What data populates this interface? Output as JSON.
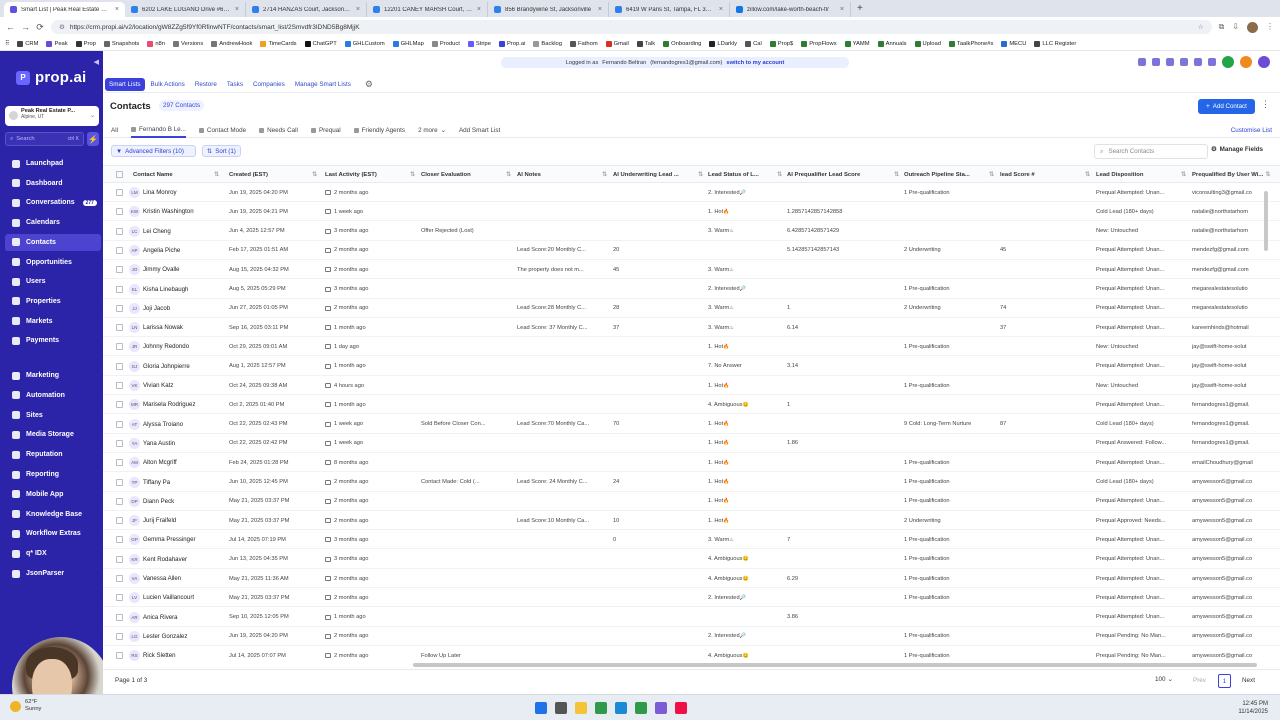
{
  "browser": {
    "tabs": [
      {
        "label": "Smart List | Peak Real Estate Pros",
        "active": true,
        "color": "#5a52e0"
      },
      {
        "label": "6202 LAKE LUGANO Drive #6202",
        "active": false,
        "color": "#2f80ed"
      },
      {
        "label": "2714 HANZAS Court, Jacksonville",
        "active": false,
        "color": "#2f80ed"
      },
      {
        "label": "12201 CANEY MARSH Court, Jack",
        "active": false,
        "color": "#2f80ed"
      },
      {
        "label": "856 Brandywine St, Jacksonville",
        "active": false,
        "color": "#2f80ed"
      },
      {
        "label": "6419 W Paris St, Tampa, FL 3363",
        "active": false,
        "color": "#2f80ed"
      },
      {
        "label": "zillow.com/lake-worth-beach-fl/",
        "active": false,
        "color": "#1277e1"
      }
    ],
    "url": "https://crm.propi.ai/v2/location/gW8ZZg5f9Yf0RfinwNTF/contacts/smart_list/2Smvdfr3IDND5Bg8MjjK",
    "bookmarks": [
      {
        "label": "CRM",
        "color": "#444"
      },
      {
        "label": "Peak",
        "color": "#6b4bd8"
      },
      {
        "label": "Prop",
        "color": "#333"
      },
      {
        "label": "Snapshots",
        "color": "#666"
      },
      {
        "label": "n8n",
        "color": "#ea4b71"
      },
      {
        "label": "Versions",
        "color": "#777"
      },
      {
        "label": "AndrewHook",
        "color": "#777"
      },
      {
        "label": "TimeCards",
        "color": "#f0a020"
      },
      {
        "label": "ChatGPT",
        "color": "#111"
      },
      {
        "label": "GHLCustom",
        "color": "#2a7ae4"
      },
      {
        "label": "GHLMap",
        "color": "#2a7ae4"
      },
      {
        "label": "Product",
        "color": "#888"
      },
      {
        "label": "Stripe",
        "color": "#635bff"
      },
      {
        "label": "Prop.ai",
        "color": "#3b42d9"
      },
      {
        "label": "Backlog",
        "color": "#999"
      },
      {
        "label": "Fathom",
        "color": "#555"
      },
      {
        "label": "Gmail",
        "color": "#d93025"
      },
      {
        "label": "Talk",
        "color": "#444"
      },
      {
        "label": "Onboarding",
        "color": "#2e7d32"
      },
      {
        "label": "LDarkly",
        "color": "#222"
      },
      {
        "label": "Cal",
        "color": "#555"
      },
      {
        "label": "Prop$",
        "color": "#2e7d32"
      },
      {
        "label": "PropFlows",
        "color": "#2e7d32"
      },
      {
        "label": "YAMM",
        "color": "#2e7d32"
      },
      {
        "label": "Annuals",
        "color": "#2e7d32"
      },
      {
        "label": "Upload",
        "color": "#2e7d32"
      },
      {
        "label": "TaalkPhone#s",
        "color": "#2e7d32"
      },
      {
        "label": "MECU",
        "color": "#2a6bd4"
      },
      {
        "label": "LLC Register",
        "color": "#444"
      }
    ]
  },
  "sidebar": {
    "brand": "prop.ai",
    "account_name": "Peak Real Estate P...",
    "account_location": "Alpine, UT",
    "search_placeholder": "Search",
    "search_shortcut": "ctrl K",
    "items": [
      {
        "label": "Launchpad"
      },
      {
        "label": "Dashboard"
      },
      {
        "label": "Conversations",
        "badge": "277"
      },
      {
        "label": "Calendars"
      },
      {
        "label": "Contacts",
        "selected": true
      },
      {
        "label": "Opportunities"
      },
      {
        "label": "Users"
      },
      {
        "label": "Properties"
      },
      {
        "label": "Markets"
      },
      {
        "label": "Payments"
      }
    ],
    "items2": [
      {
        "label": "Marketing"
      },
      {
        "label": "Automation"
      },
      {
        "label": "Sites"
      },
      {
        "label": "Media Storage"
      },
      {
        "label": "Reputation"
      },
      {
        "label": "Reporting"
      },
      {
        "label": "Mobile App"
      },
      {
        "label": "Knowledge Base"
      },
      {
        "label": "Workflow Extras"
      },
      {
        "label": "q* IDX"
      },
      {
        "label": "JsonParser"
      }
    ]
  },
  "banner": {
    "prefix": "Logged in as",
    "user": "Fernando Beltran",
    "email": "(fernandogres1@gmail.com)",
    "link": "switch to my account"
  },
  "subnav": [
    "Smart Lists",
    "Bulk Actions",
    "Restore",
    "Tasks",
    "Companies",
    "Manage Smart Lists"
  ],
  "page": {
    "title": "Contacts",
    "count": "297 Contacts",
    "add_button": "Add Contact"
  },
  "list_tabs": [
    "All",
    "Fernando B Le...",
    "Contact Mode",
    "Needs Call",
    "Prequal",
    "Friendly Agents",
    "2 more",
    "Add Smart List"
  ],
  "customise": "Customise List",
  "filters": {
    "advanced": "Advanced Filters (10)",
    "sort": "Sort (1)",
    "search_placeholder": "Search Contacts",
    "manage_fields": "Manage Fields"
  },
  "columns": [
    "Contact Name",
    "Created (EST)",
    "Last Activity (EST)",
    "Closer Evaluation",
    "AI Notes",
    "AI Underwriting Lead ...",
    "Lead Status of L...",
    "AI Prequalifier Lead Score",
    "Outreach Pipeline Sta...",
    "lead Score #",
    "Lead Disposition",
    "Prequalified By User Wi..."
  ],
  "rows": [
    {
      "init": "LM",
      "name": "Lina Monroy",
      "created": "Jun 19, 2025 04:20 PM",
      "last": "2 months ago",
      "closer": "",
      "notes": "",
      "uw": "",
      "status": "2. Interested",
      "pq": "",
      "pipe": "1 Pre-qualification",
      "ls": "",
      "disp": "Prequal Attempted: Unan...",
      "by": "viconsulting3@gmail.co"
    },
    {
      "init": "KW",
      "name": "Kristin Washington",
      "created": "Jun 19, 2025 04:21 PM",
      "last": "1 week ago",
      "closer": "",
      "notes": "",
      "uw": "",
      "status": "1. Hot",
      "pq": "1.2857142857142858",
      "pipe": "",
      "ls": "",
      "disp": "Cold Lead (180+ days)",
      "by": "natalie@northstarhom"
    },
    {
      "init": "LC",
      "name": "Lei Cheng",
      "created": "Jun 4, 2025 12:57 PM",
      "last": "3 months ago",
      "closer": "Offer Rejected (Lost)",
      "notes": "",
      "uw": "",
      "status": "3. Warm",
      "pq": "6.428571428571429",
      "pipe": "",
      "ls": "",
      "disp": "New: Untouched",
      "by": "natalie@northstarhom"
    },
    {
      "init": "AP",
      "name": "Angelia Piche",
      "created": "Feb 17, 2025 01:51 AM",
      "last": "2 months ago",
      "closer": "",
      "notes": "Lead Score:20 Monthly C...",
      "uw": "20",
      "status": "",
      "pq": "5.142857142857143",
      "pipe": "2 Underwriting",
      "ls": "45",
      "disp": "Prequal Attempted: Unan...",
      "by": "mendezfg@gmail.com"
    },
    {
      "init": "JO",
      "name": "Jimmy Ovalle",
      "created": "Aug 15, 2025 04:32 PM",
      "last": "2 months ago",
      "closer": "",
      "notes": "The property does not m...",
      "uw": "45",
      "status": "3. Warm",
      "pq": "",
      "pipe": "",
      "ls": "",
      "disp": "Prequal Attempted: Unan...",
      "by": "mendezfg@gmail.com"
    },
    {
      "init": "KL",
      "name": "Kisha Linebaugh",
      "created": "Aug 5, 2025 05:29 PM",
      "last": "3 months ago",
      "closer": "",
      "notes": "",
      "uw": "",
      "status": "2. Interested",
      "pq": "",
      "pipe": "1 Pre-qualification",
      "ls": "",
      "disp": "Prequal Attempted: Unan...",
      "by": "megarealestatesolutio"
    },
    {
      "init": "JJ",
      "name": "Joji Jacob",
      "created": "Jun 27, 2025 01:05 PM",
      "last": "2 months ago",
      "closer": "",
      "notes": "Lead Score:28 Monthly C...",
      "uw": "28",
      "status": "3. Warm",
      "pq": "1",
      "pipe": "2 Underwriting",
      "ls": "74",
      "disp": "Prequal Attempted: Unan...",
      "by": "megarealestatesolutio"
    },
    {
      "init": "LN",
      "name": "Larissa Nowak",
      "created": "Sep 16, 2025 03:11 PM",
      "last": "1 month ago",
      "closer": "",
      "notes": "Lead Score: 37 Monthly C...",
      "uw": "37",
      "status": "3. Warm",
      "pq": "6.14",
      "pipe": "",
      "ls": "37",
      "disp": "Prequal Attempted: Unan...",
      "by": "kareemhinds@hotmail"
    },
    {
      "init": "JR",
      "name": "Johnny Redondo",
      "created": "Oct 29, 2025 09:01 AM",
      "last": "1 day ago",
      "closer": "",
      "notes": "",
      "uw": "",
      "status": "1. Hot",
      "pq": "",
      "pipe": "1 Pre-qualification",
      "ls": "",
      "disp": "New: Untouched",
      "by": "jay@swift-home-solut"
    },
    {
      "init": "GJ",
      "name": "Gloria Johnpierre",
      "created": "Aug 1, 2025 12:57 PM",
      "last": "1 month ago",
      "closer": "",
      "notes": "",
      "uw": "",
      "status": "7. No Answer",
      "pq": "3.14",
      "pipe": "",
      "ls": "",
      "disp": "Prequal Attempted: Unan...",
      "by": "jay@swift-home-solut"
    },
    {
      "init": "VK",
      "name": "Vivian Katz",
      "created": "Oct 24, 2025 09:38 AM",
      "last": "4 hours ago",
      "closer": "",
      "notes": "",
      "uw": "",
      "status": "1. Hot",
      "pq": "",
      "pipe": "1 Pre-qualification",
      "ls": "",
      "disp": "New: Untouched",
      "by": "jay@swift-home-solut"
    },
    {
      "init": "MR",
      "name": "Marisela Rodriguez",
      "created": "Oct 2, 2025 01:40 PM",
      "last": "1 month ago",
      "closer": "",
      "notes": "",
      "uw": "",
      "status": "4. Ambiguous",
      "pq": "1",
      "pipe": "",
      "ls": "",
      "disp": "Prequal Attempted: Unan...",
      "by": "fernandogres1@gmail."
    },
    {
      "init": "AT",
      "name": "Alyssa Troiano",
      "created": "Oct 22, 2025 02:43 PM",
      "last": "1 week ago",
      "closer": "Sold Before Closer Con...",
      "notes": "Lead Score:70 Monthly Ca...",
      "uw": "70",
      "status": "1. Hot",
      "pq": "",
      "pipe": "9 Cold: Long-Term Nurture",
      "ls": "87",
      "disp": "Cold Lead (180+ days)",
      "by": "fernandogres1@gmail."
    },
    {
      "init": "YA",
      "name": "Yana Austin",
      "created": "Oct 22, 2025 02:42 PM",
      "last": "1 week ago",
      "closer": "",
      "notes": "",
      "uw": "",
      "status": "1. Hot",
      "pq": "1.86",
      "pipe": "",
      "ls": "",
      "disp": "Prequal Answered: Follow...",
      "by": "fernandogres1@gmail."
    },
    {
      "init": "AM",
      "name": "Alton Mcgriff",
      "created": "Feb 24, 2025 01:28 PM",
      "last": "8 months ago",
      "closer": "",
      "notes": "",
      "uw": "",
      "status": "1. Hot",
      "pq": "",
      "pipe": "1 Pre-qualification",
      "ls": "",
      "disp": "Prequal Attempted: Unan...",
      "by": "emailChoudhury@gmail"
    },
    {
      "init": "TP",
      "name": "Tiffany Pa",
      "created": "Jun 10, 2025 12:45 PM",
      "last": "2 months ago",
      "closer": "Contact Made: Cold (...",
      "notes": "Lead Score: 24 Monthly C...",
      "uw": "24",
      "status": "1. Hot",
      "pq": "",
      "pipe": "1 Pre-qualification",
      "ls": "",
      "disp": "Cold Lead (180+ days)",
      "by": "amywesson5@gmail.co"
    },
    {
      "init": "DP",
      "name": "Diann Peck",
      "created": "May 21, 2025 03:37 PM",
      "last": "2 months ago",
      "closer": "",
      "notes": "",
      "uw": "",
      "status": "1. Hot",
      "pq": "",
      "pipe": "1 Pre-qualification",
      "ls": "",
      "disp": "Prequal Attempted: Unan...",
      "by": "amywesson5@gmail.co"
    },
    {
      "init": "JF",
      "name": "Jurij Fraifeld",
      "created": "May 21, 2025 03:37 PM",
      "last": "2 months ago",
      "closer": "",
      "notes": "Lead Score:10 Monthly Ca...",
      "uw": "10",
      "status": "1. Hot",
      "pq": "",
      "pipe": "2 Underwriting",
      "ls": "",
      "disp": "Prequal Approved: Needs...",
      "by": "amywesson5@gmail.co"
    },
    {
      "init": "GP",
      "name": "Gemma Pressinger",
      "created": "Jul 14, 2025 07:19 PM",
      "last": "3 months ago",
      "closer": "",
      "notes": "",
      "uw": "0",
      "status": "3. Warm",
      "pq": "7",
      "pipe": "1 Pre-qualification",
      "ls": "",
      "disp": "Prequal Attempted: Unan...",
      "by": "amywesson5@gmail.co"
    },
    {
      "init": "KR",
      "name": "Kent Rodahaver",
      "created": "Jun 13, 2025 04:35 PM",
      "last": "3 months ago",
      "closer": "",
      "notes": "",
      "uw": "",
      "status": "4. Ambiguous",
      "pq": "",
      "pipe": "1 Pre-qualification",
      "ls": "",
      "disp": "Prequal Attempted: Unan...",
      "by": "amywesson5@gmail.co"
    },
    {
      "init": "VA",
      "name": "Vanessa Allen",
      "created": "May 21, 2025 11:36 AM",
      "last": "2 months ago",
      "closer": "",
      "notes": "",
      "uw": "",
      "status": "4. Ambiguous",
      "pq": "6.29",
      "pipe": "1 Pre-qualification",
      "ls": "",
      "disp": "Prequal Attempted: Unan...",
      "by": "amywesson5@gmail.co"
    },
    {
      "init": "LV",
      "name": "Lucien Vaillancourt",
      "created": "May 21, 2025 03:37 PM",
      "last": "2 months ago",
      "closer": "",
      "notes": "",
      "uw": "",
      "status": "2. Interested",
      "pq": "",
      "pipe": "1 Pre-qualification",
      "ls": "",
      "disp": "Prequal Attempted: Unan...",
      "by": "amywesson5@gmail.co"
    },
    {
      "init": "AR",
      "name": "Anica Rivera",
      "created": "Sep 10, 2025 12:05 PM",
      "last": "1 month ago",
      "closer": "",
      "notes": "",
      "uw": "",
      "status": "",
      "pq": "3.86",
      "pipe": "",
      "ls": "",
      "disp": "Prequal Attempted: Unan...",
      "by": "amywesson5@gmail.co"
    },
    {
      "init": "LG",
      "name": "Lester Gonzalez",
      "created": "Jun 19, 2025 04:20 PM",
      "last": "2 months ago",
      "closer": "",
      "notes": "",
      "uw": "",
      "status": "2. Interested",
      "pq": "",
      "pipe": "1 Pre-qualification",
      "ls": "",
      "disp": "Prequal Pending: No Man...",
      "by": "amywesson5@gmail.co"
    },
    {
      "init": "RS",
      "name": "Rick Sletten",
      "created": "Jul 14, 2025 07:07 PM",
      "last": "2 months ago",
      "closer": "Follow Up Later",
      "notes": "",
      "uw": "",
      "status": "4. Ambiguous",
      "pq": "",
      "pipe": "1 Pre-qualification",
      "ls": "",
      "disp": "Prequal Pending: No Man...",
      "by": "amywesson5@gmail.co"
    }
  ],
  "footer": {
    "page": "Page 1 of 3",
    "per_page": "100",
    "prev": "Prev",
    "current": "1",
    "next": "Next"
  },
  "taskbar": {
    "temp": "62°F",
    "cond": "Sunny",
    "time": "12:45 PM",
    "date": "11/14/2025"
  }
}
